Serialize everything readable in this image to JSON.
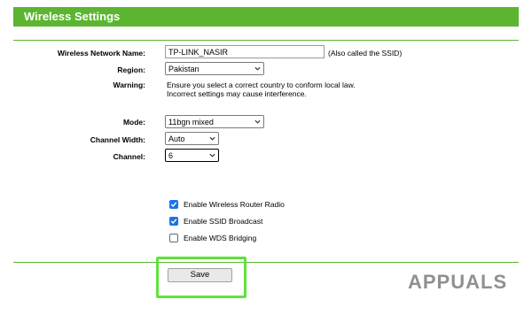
{
  "header": {
    "title": "Wireless Settings"
  },
  "form": {
    "network_name": {
      "label": "Wireless Network Name:",
      "value": "TP-LINK_NASIR",
      "hint": "(Also called the SSID)"
    },
    "region": {
      "label": "Region:",
      "value": "Pakistan"
    },
    "warning": {
      "label": "Warning:",
      "line1": "Ensure you select a correct country to conform local law.",
      "line2": "Incorrect settings may cause interference."
    },
    "mode": {
      "label": "Mode:",
      "value": "11bgn mixed"
    },
    "channel_width": {
      "label": "Channel Width:",
      "value": "Auto"
    },
    "channel": {
      "label": "Channel:",
      "value": "6"
    }
  },
  "options": [
    {
      "label": "Enable Wireless Router Radio",
      "checked": true
    },
    {
      "label": "Enable SSID Broadcast",
      "checked": true
    },
    {
      "label": "Enable WDS Bridging",
      "checked": false
    }
  ],
  "actions": {
    "save_label": "Save"
  },
  "watermark": {
    "text": "APPUALS"
  },
  "colors": {
    "header_green": "#5cb531",
    "highlight_green": "#5fe33d",
    "checkbox_blue": "#1a73e8"
  }
}
